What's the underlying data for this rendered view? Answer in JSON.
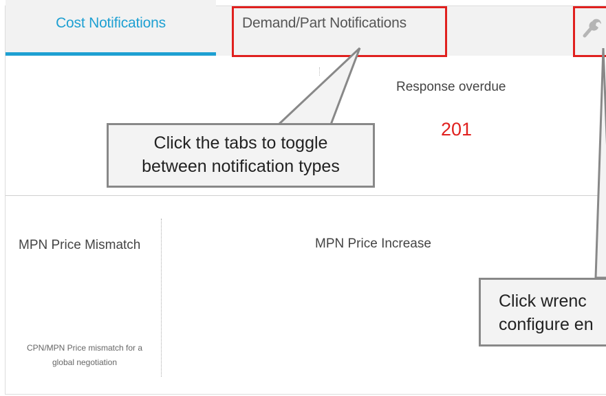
{
  "tabs": {
    "cost_label": "Cost Notifications",
    "demand_label": "Demand/Part Notifications"
  },
  "overdue": {
    "label": "Response overdue",
    "value": "201"
  },
  "cards": {
    "mismatch_title": "MPN Price Mismatch",
    "mismatch_desc": "CPN/MPN Price mismatch for a global negotiation",
    "increase_title": "MPN Price Increase"
  },
  "callouts": {
    "tabs_line1": "Click the tabs to toggle",
    "tabs_line2": "between notification types",
    "wrench_line1": "Click wrenc",
    "wrench_line2": "configure en"
  },
  "colors": {
    "accent": "#1ea0d2",
    "highlight": "#e0201e",
    "overdue": "#e0201e"
  },
  "icons": {
    "settings": "wrench-icon"
  }
}
